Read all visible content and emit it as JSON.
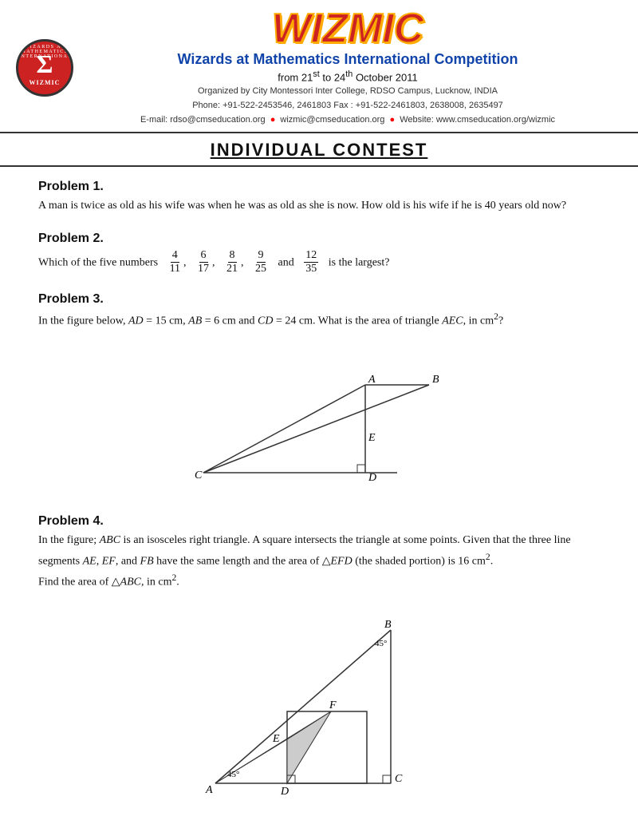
{
  "header": {
    "logo_sigma": "Σ",
    "logo_wizmic": "WIZMIC",
    "arc_text": "WIZARDS AT MATHEMATICS INTERNATIONAL COMPETITION",
    "title": "WIZMIC",
    "subtitle": "Wizards at Mathematics International Competition",
    "date_line": "from 21st to 24th October 2011",
    "org_line1": "Organized by City Montessori Inter College, RDSO Campus, Lucknow, INDIA",
    "org_line2": "Phone: +91-522-2453546, 2461803 Fax : +91-522-2461803, 2638008, 2635497",
    "org_line3_email1": "rdso@cmseducation.org",
    "org_line3_sep1": "●",
    "org_line3_email2": "wizmic@cmseducation.org",
    "org_line3_sep2": "●",
    "org_line3_web": "Website: www.cmseducation.org/wizmic"
  },
  "banner": {
    "text": "INDIVIDUAL CONTEST"
  },
  "problems": [
    {
      "id": "problem-1",
      "title": "Problem 1.",
      "text": "A man is twice as old as his wife was when he was as old as she is now. How old is his wife if he is 40 years old now?"
    },
    {
      "id": "problem-2",
      "title": "Problem 2.",
      "intro": "Which of the five numbers",
      "numbers": [
        {
          "num": "4",
          "den": "11"
        },
        {
          "num": "6",
          "den": "17"
        },
        {
          "num": "8",
          "den": "21"
        },
        {
          "num": "9",
          "den": "25"
        },
        {
          "num": "12",
          "den": "35"
        }
      ],
      "outro": "is the largest?"
    },
    {
      "id": "problem-3",
      "title": "Problem 3.",
      "text": "In the figure below, AD = 15 cm, AB = 6 cm and CD = 24 cm. What is the area of triangle AEC, in cm²?"
    },
    {
      "id": "problem-4",
      "title": "Problem 4.",
      "text1": "In the figure; ABC is an isosceles right triangle. A square intersects the triangle at some points. Given that the three line segments AE, EF, and FB have the same length and the area of △EFD (the shaded portion) is 16 cm².",
      "text2": "Find the area of △ABC, in cm²."
    }
  ]
}
